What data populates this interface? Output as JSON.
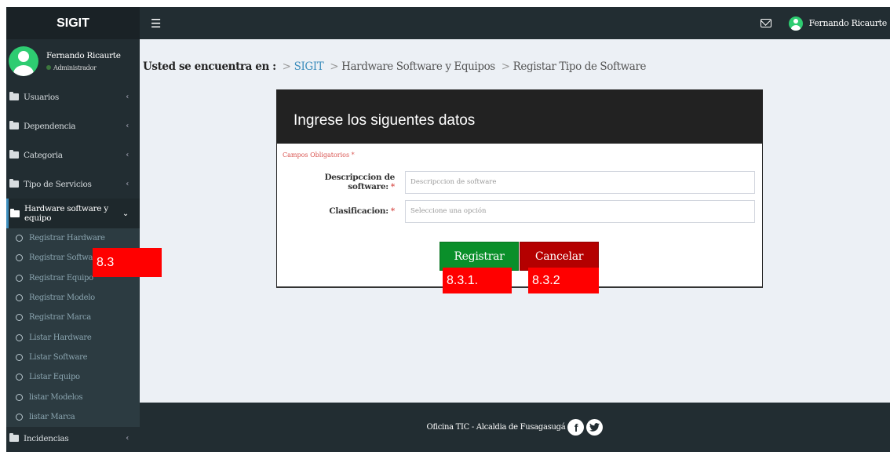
{
  "app": {
    "brand": "SIGIT"
  },
  "topbar": {
    "user_name": "Fernando Ricaurte"
  },
  "sidebar": {
    "user_name": "Fernando Ricaurte",
    "user_role": "Administrador",
    "items": [
      {
        "label": "Usuarios"
      },
      {
        "label": "Dependencia"
      },
      {
        "label": "Categoria"
      },
      {
        "label": "Tipo de Servicios"
      },
      {
        "label": "Hardware software y equipo"
      }
    ],
    "submenu": [
      {
        "label": "Registrar Hardware"
      },
      {
        "label": "Registrar Software"
      },
      {
        "label": "Registrar Equipo"
      },
      {
        "label": "Registrar Modelo"
      },
      {
        "label": "Registrar Marca"
      },
      {
        "label": "Listar Hardware"
      },
      {
        "label": "Listar Software"
      },
      {
        "label": "Listar Equipo"
      },
      {
        "label": "listar Modelos"
      },
      {
        "label": "listar Marca"
      }
    ],
    "last_item": {
      "label": "Incidencias"
    }
  },
  "breadcrumb": {
    "lead": "Usted se encuentra en :",
    "sep": ">",
    "items": [
      "SIGIT",
      "Hardware Software y Equipos",
      "Registar Tipo de Software"
    ]
  },
  "form": {
    "title": "Ingrese los siguentes datos",
    "required_note": "Campos Obligatorios *",
    "required_mark": "*",
    "description_label": "Descripccion de software:",
    "description_placeholder": "Descripccion de software",
    "classification_label": "Clasificacion:",
    "classification_value": "Seleccione una opción",
    "submit_label": "Registrar",
    "cancel_label": "Cancelar"
  },
  "annotations": {
    "a": "8.3",
    "b": "8.3.1.",
    "c": "8.3.2"
  },
  "footer": {
    "text": "Oficina TIC - Alcaldia de Fusagasugá",
    "facebook": "f"
  },
  "colors": {
    "accent": "#3c8dbc",
    "submit": "#0a8f2a",
    "cancel": "#b40000",
    "annotation": "#ff0000"
  }
}
